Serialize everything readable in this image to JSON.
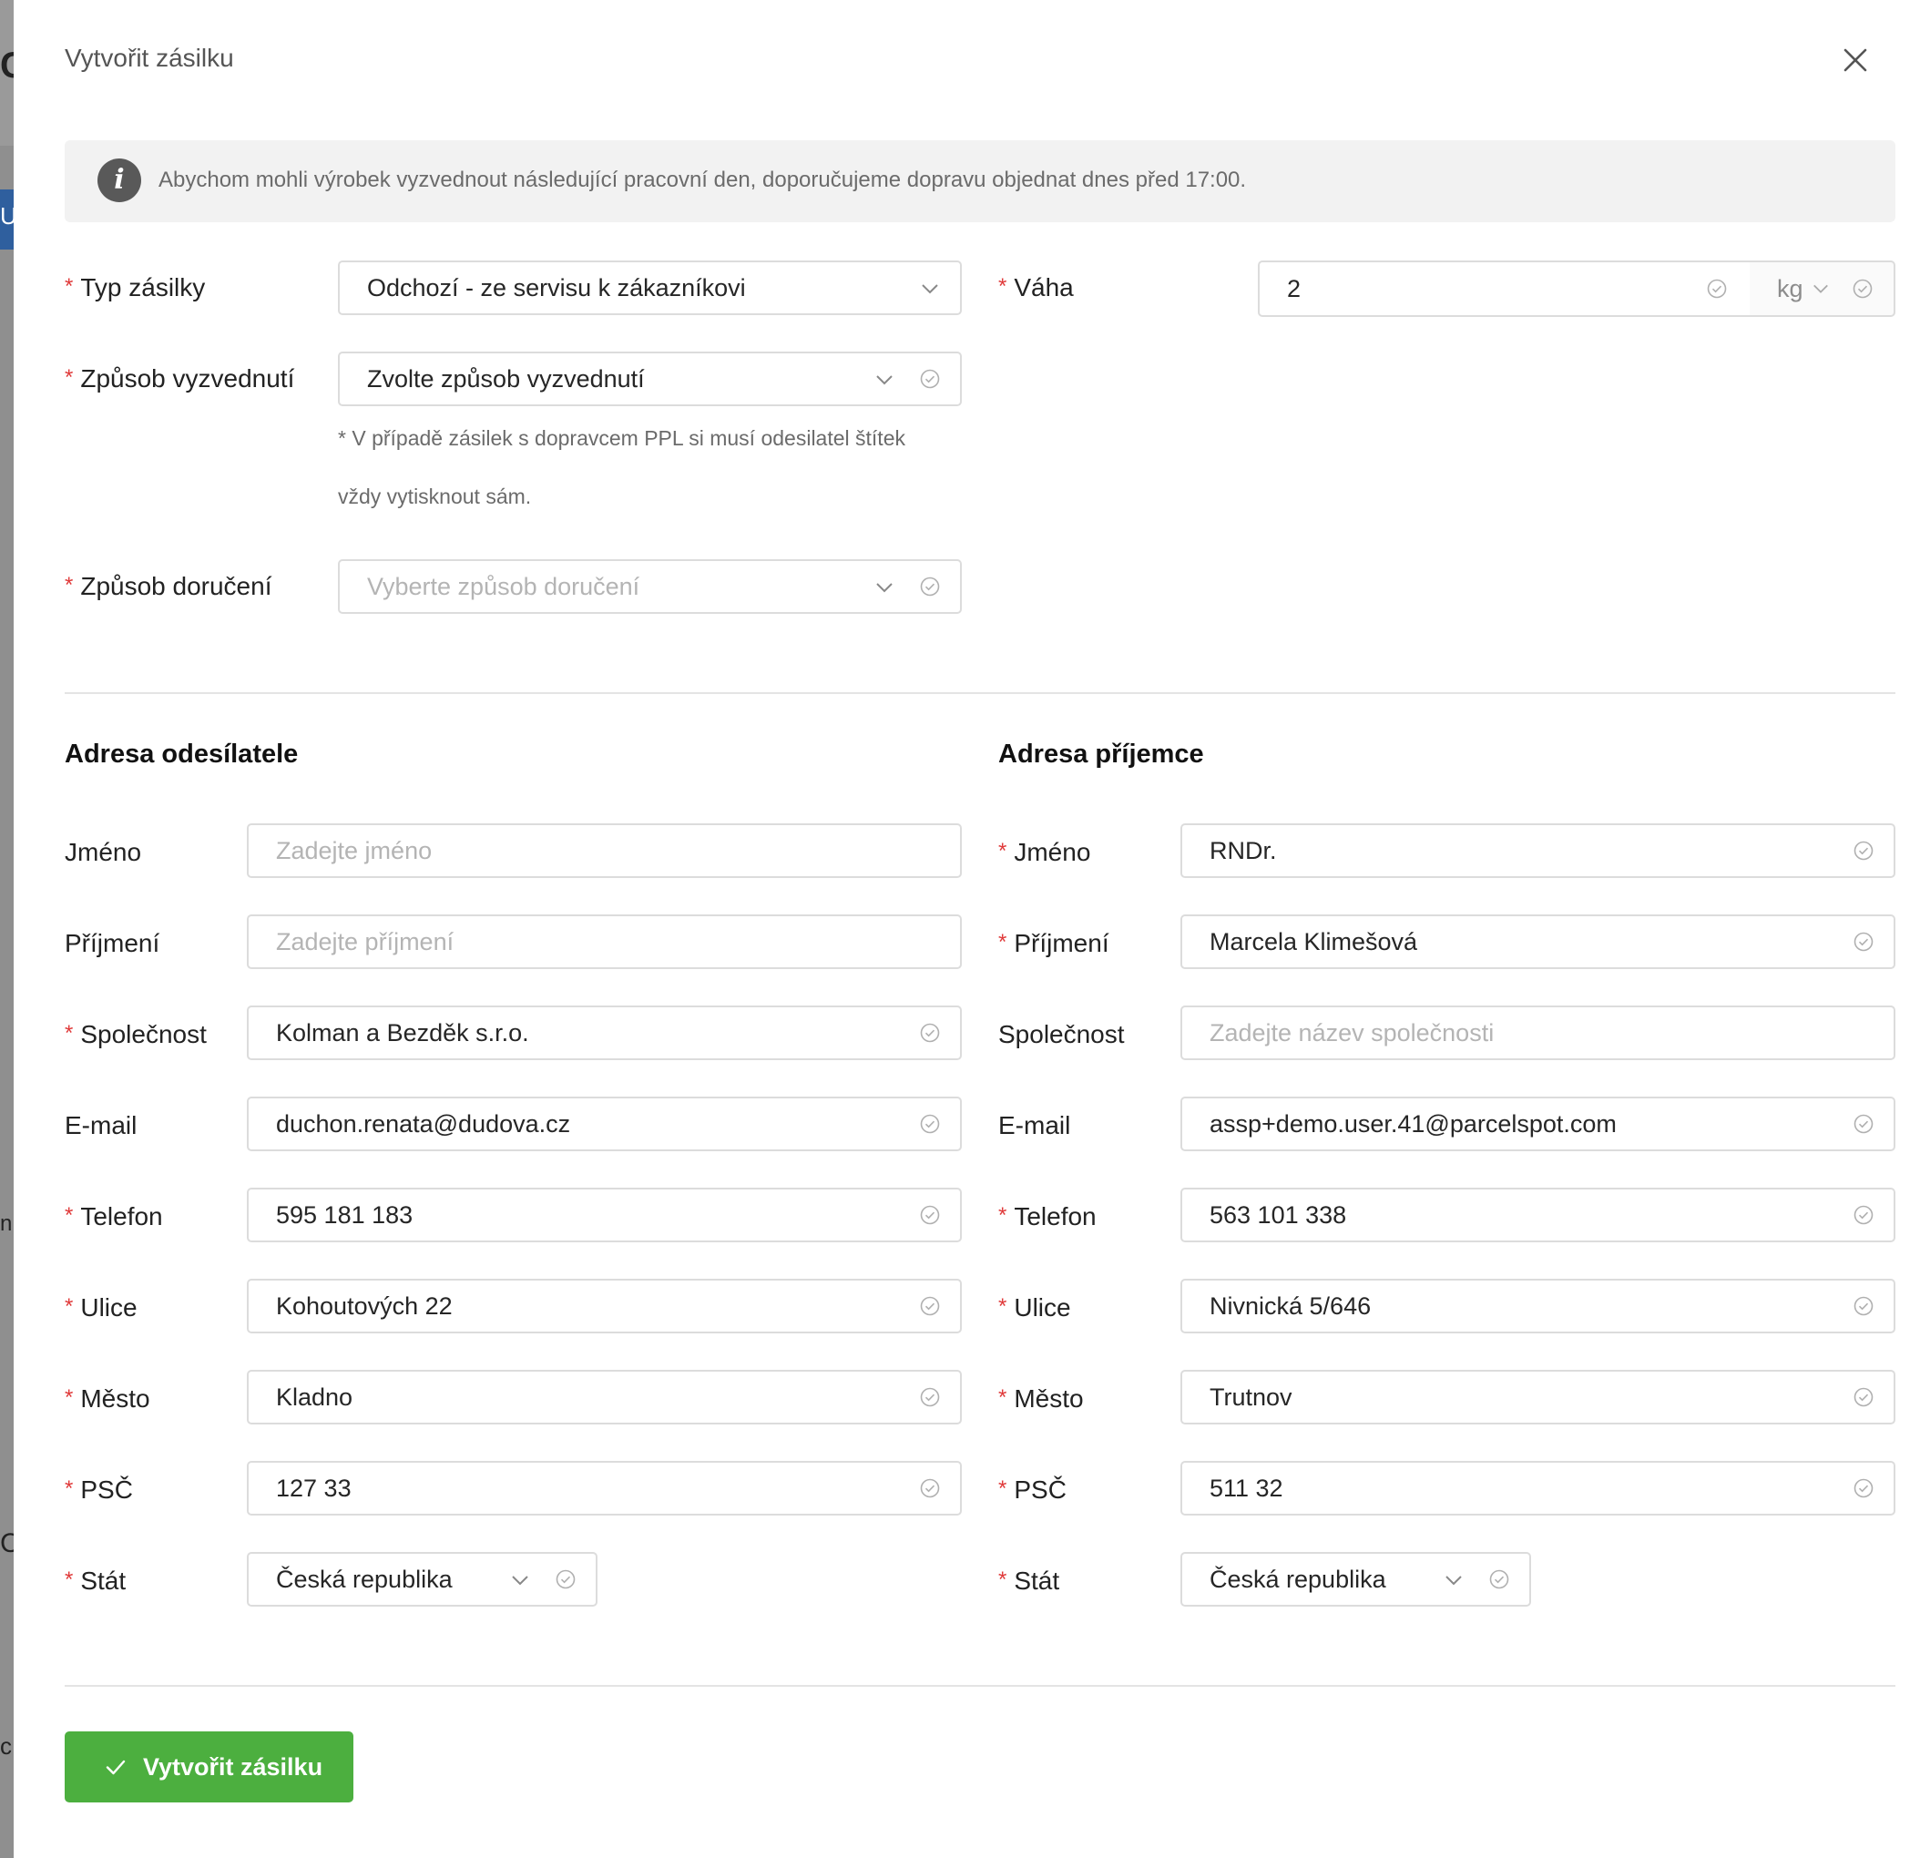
{
  "dialog": {
    "title": "Vytvořit zásilku",
    "info": "Abychom mohli výrobek vyzvednout následující pracovní den, doporučujeme dopravu objednat dnes před 17:00."
  },
  "shipment": {
    "type_label": "Typ zásilky",
    "type_value": "Odchozí - ze servisu k zákazníkovi",
    "pickup_label": "Způsob vyzvednutí",
    "pickup_value": "Zvolte způsob vyzvednutí",
    "pickup_hint_line1": "* V případě zásilek s dopravcem PPL si musí odesilatel štítek",
    "pickup_hint_line2": "vždy vytisknout sám.",
    "delivery_label": "Způsob doručení",
    "delivery_placeholder": "Vyberte způsob doručení",
    "weight_label": "Váha",
    "weight_value": "2",
    "weight_unit": "kg"
  },
  "sender": {
    "heading": "Adresa odesílatele",
    "first_name_label": "Jméno",
    "first_name_placeholder": "Zadejte jméno",
    "last_name_label": "Příjmení",
    "last_name_placeholder": "Zadejte příjmení",
    "company_label": "Společnost",
    "company_value": "Kolman a Bezděk s.r.o.",
    "email_label": "E-mail",
    "email_value": "duchon.renata@dudova.cz",
    "phone_label": "Telefon",
    "phone_value": "595 181 183",
    "street_label": "Ulice",
    "street_value": "Kohoutových 22",
    "city_label": "Město",
    "city_value": "Kladno",
    "zip_label": "PSČ",
    "zip_value": "127 33",
    "country_label": "Stát",
    "country_value": "Česká republika"
  },
  "recipient": {
    "heading": "Adresa příjemce",
    "first_name_label": "Jméno",
    "first_name_value": "RNDr.",
    "last_name_label": "Příjmení",
    "last_name_value": "Marcela Klimešová",
    "company_label": "Společnost",
    "company_placeholder": "Zadejte název společnosti",
    "email_label": "E-mail",
    "email_value": "assp+demo.user.41@parcelspot.com",
    "phone_label": "Telefon",
    "phone_value": "563 101 338",
    "street_label": "Ulice",
    "street_value": "Nivnická 5/646",
    "city_label": "Město",
    "city_value": "Trutnov",
    "zip_label": "PSČ",
    "zip_value": "511 32",
    "country_label": "Stát",
    "country_value": "Česká republika"
  },
  "actions": {
    "submit_label": "Vytvořit zásilku"
  },
  "background_fragments": [
    "C",
    "Up",
    "n",
    "C",
    "c"
  ],
  "colors": {
    "primary": "#4caf3f",
    "required": "#e03a3a",
    "info_bg": "#f2f2f2"
  }
}
